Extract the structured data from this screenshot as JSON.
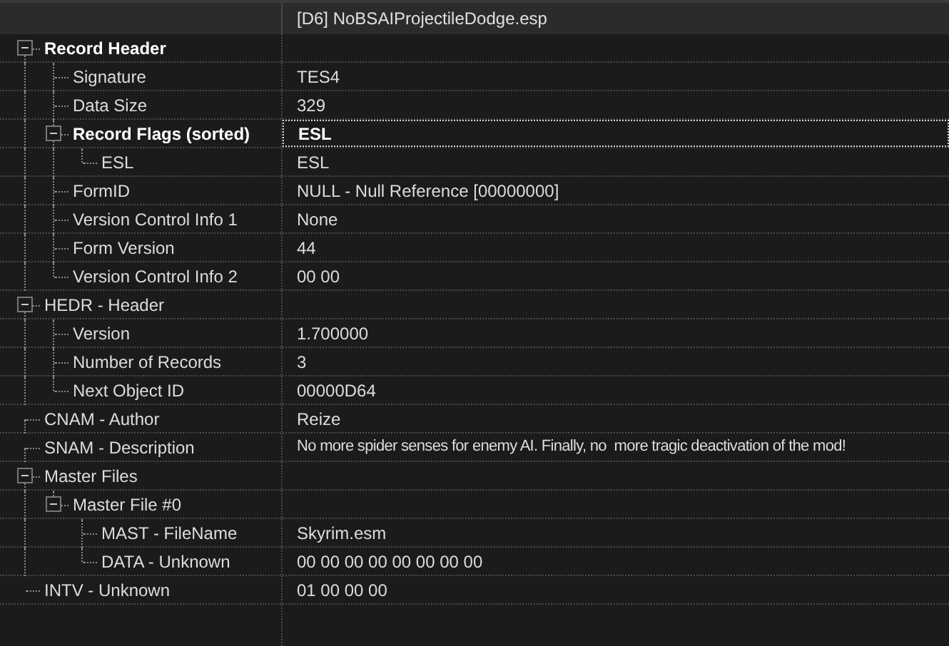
{
  "header": {
    "title": "[D6] NoBSAIProjectileDodge.esp"
  },
  "tree": [
    {
      "name": "Record Header",
      "bold": true,
      "focused": false,
      "expanded": true,
      "children": [
        {
          "name": "Signature",
          "value": "TES4",
          "bold": false,
          "focused": false
        },
        {
          "name": "Data Size",
          "value": "329",
          "bold": false,
          "focused": false
        },
        {
          "name": "Record Flags (sorted)",
          "value": "ESL",
          "bold": true,
          "focused": true,
          "expanded": true,
          "children": [
            {
              "name": "ESL",
              "value": "ESL",
              "bold": false,
              "focused": false
            }
          ]
        },
        {
          "name": "FormID",
          "value": "NULL - Null Reference [00000000]",
          "bold": false,
          "focused": false
        },
        {
          "name": "Version Control Info 1",
          "value": "None",
          "bold": false,
          "focused": false
        },
        {
          "name": "Form Version",
          "value": "44",
          "bold": false,
          "focused": false
        },
        {
          "name": "Version Control Info 2",
          "value": "00 00",
          "bold": false,
          "focused": false
        }
      ]
    },
    {
      "name": "HEDR - Header",
      "bold": false,
      "focused": false,
      "expanded": true,
      "children": [
        {
          "name": "Version",
          "value": "1.700000",
          "bold": false,
          "focused": false
        },
        {
          "name": "Number of Records",
          "value": "3",
          "bold": false,
          "focused": false
        },
        {
          "name": "Next Object ID",
          "value": "00000D64",
          "bold": false,
          "focused": false
        }
      ]
    },
    {
      "name": "CNAM - Author",
      "value": "Reize",
      "bold": false,
      "focused": false
    },
    {
      "name": "SNAM - Description",
      "value": "No more spider senses for enemy AI. Finally, no  more tragic deactivation of the mod!",
      "bold": false,
      "focused": false
    },
    {
      "name": "Master Files",
      "bold": false,
      "focused": false,
      "expanded": true,
      "children": [
        {
          "name": "Master File #0",
          "bold": false,
          "focused": false,
          "expanded": true,
          "children": [
            {
              "name": "MAST - FileName",
              "value": "Skyrim.esm",
              "bold": false,
              "focused": false
            },
            {
              "name": "DATA - Unknown",
              "value": "00 00 00 00 00 00 00 00",
              "bold": false,
              "focused": false
            }
          ]
        }
      ]
    },
    {
      "name": "INTV - Unknown",
      "value": "01 00 00 00",
      "bold": false,
      "focused": false
    }
  ]
}
